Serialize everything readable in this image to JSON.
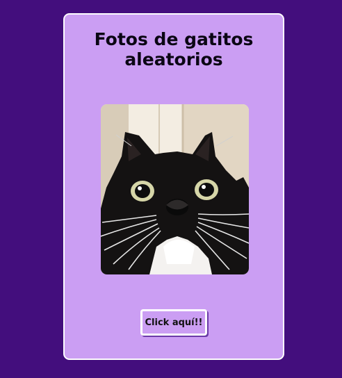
{
  "page": {
    "title": "Fotos de gatitos aleatorios"
  },
  "photo": {
    "alt_subject": "cat-photo"
  },
  "action": {
    "button_label": "Click aquí!!"
  },
  "colors": {
    "background": "#430e7d",
    "card": "#cb9ef3",
    "card_border": "#ffffff",
    "button_shadow": "#6a3aa8"
  }
}
